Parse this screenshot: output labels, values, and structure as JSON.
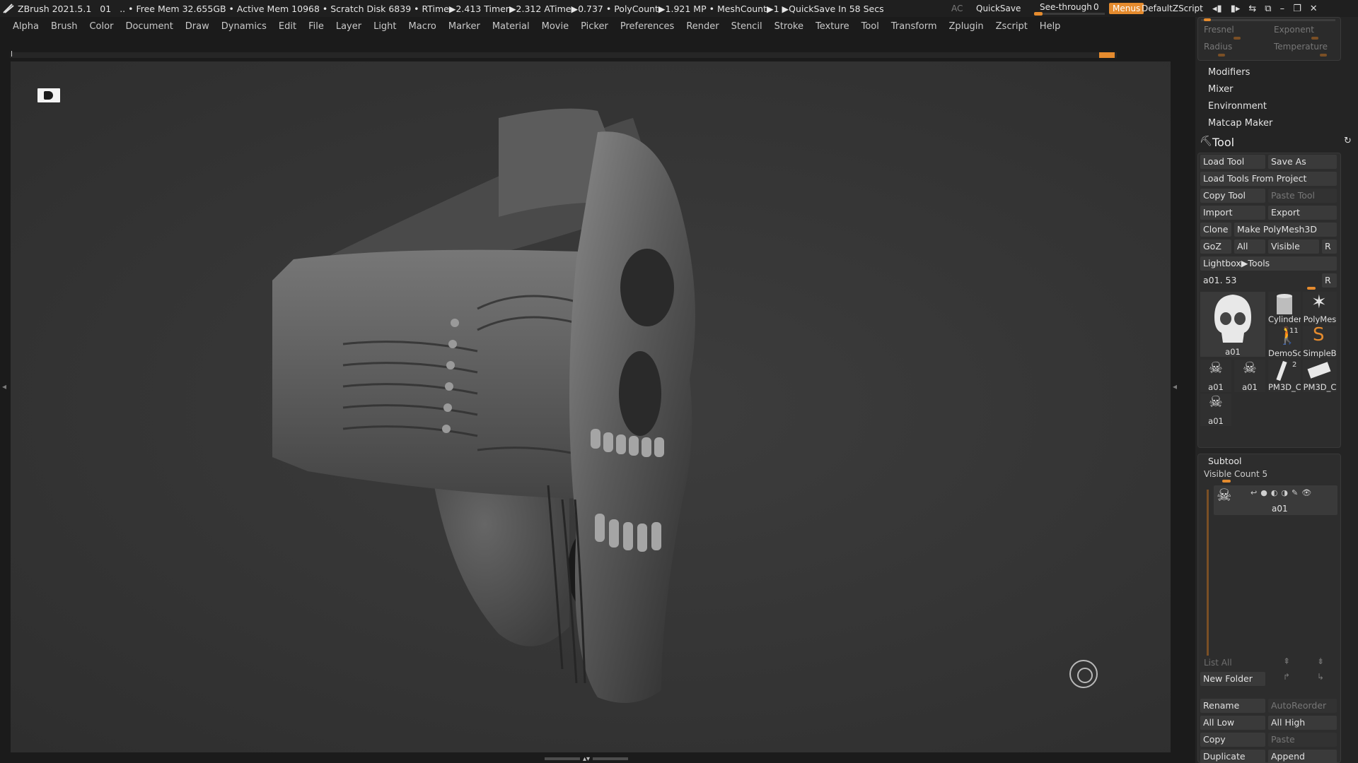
{
  "titlebar": {
    "app": "ZBrush 2021.5.1",
    "doc": "01",
    "status": ".. • Free Mem 32.655GB • Active Mem 10968 • Scratch Disk 6839 •  RTime▶2.413 Timer▶2.312 ATime▶0.737 • PolyCount▶1.921 MP  • MeshCount▶1  ▶QuickSave In 58 Secs",
    "ac": "AC",
    "quicksave": "QuickSave",
    "seethrough_label": "See-through",
    "seethrough_value": "0",
    "seethrough_level": 0,
    "menus": "Menus",
    "script": "DefaultZScript"
  },
  "menubar": [
    "Alpha",
    "Brush",
    "Color",
    "Document",
    "Draw",
    "Dynamics",
    "Edit",
    "File",
    "Layer",
    "Light",
    "Macro",
    "Marker",
    "Material",
    "Movie",
    "Picker",
    "Preferences",
    "Render",
    "Stencil",
    "Stroke",
    "Texture",
    "Tool",
    "Transform",
    "Zplugin",
    "Zscript",
    "Help"
  ],
  "light_panel": {
    "fresnel": "Fresnel",
    "exponent": "Exponent",
    "radius": "Radius",
    "temperature": "Temperature"
  },
  "subpalettes": [
    "Modifiers",
    "Mixer",
    "Environment",
    "Matcap Maker"
  ],
  "tool": {
    "title": "Tool",
    "load_tool": "Load Tool",
    "save_as": "Save As",
    "load_from_project": "Load Tools From Project",
    "copy_tool": "Copy Tool",
    "paste_tool": "Paste Tool",
    "import": "Import",
    "export": "Export",
    "clone": "Clone",
    "make_polymesh": "Make PolyMesh3D",
    "goz": "GoZ",
    "all": "All",
    "visible": "Visible",
    "r": "R",
    "lightbox": "Lightbox▶Tools",
    "current_tool": "a01. 53",
    "slots": {
      "main": "a01",
      "cylinder": "Cylinder",
      "polymesh": "PolyMes",
      "demo": "DemoSc",
      "demo_badge": "11",
      "simple": "SimpleB",
      "a01_1": "a01",
      "a01_2": "a01",
      "pm1": "PM3D_C",
      "pm1_badge": "2",
      "pm2": "PM3D_C",
      "a01_3": "a01"
    }
  },
  "subtool": {
    "title": "Subtool",
    "visible_count": "Visible Count 5",
    "item_name": "a01",
    "list_all": "List All",
    "new_folder": "New Folder",
    "rename": "Rename",
    "autoreorder": "AutoReorder",
    "all_low": "All Low",
    "all_high": "All High",
    "copy": "Copy",
    "paste": "Paste",
    "duplicate": "Duplicate",
    "append": "Append"
  },
  "colors": {
    "accent": "#e58b2e",
    "panel": "#2d2d2d",
    "canvas": "#363636"
  }
}
